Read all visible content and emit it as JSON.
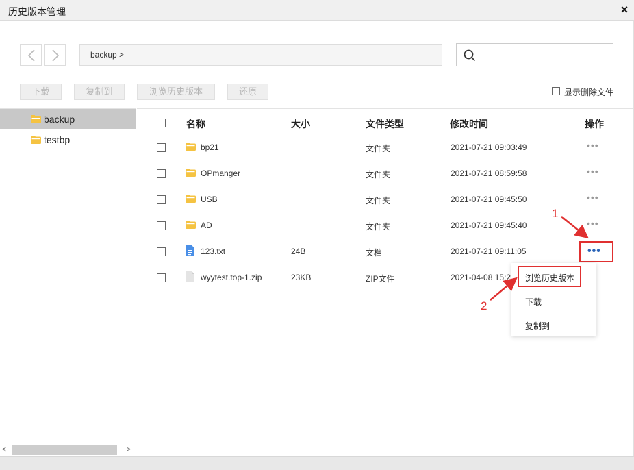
{
  "window": {
    "title": "历史版本管理",
    "close_glyph": "×"
  },
  "nav": {
    "back_icon": "chevron-left-icon",
    "forward_icon": "chevron-right-icon"
  },
  "breadcrumb": {
    "text": "backup  >"
  },
  "search": {
    "value": "",
    "placeholder": ""
  },
  "toolbar": {
    "download": "下载",
    "copy_to": "复制到",
    "browse_history": "浏览历史版本",
    "restore": "还原"
  },
  "show_deleted": {
    "label": "显示删除文件",
    "checked": false
  },
  "tree": [
    {
      "name": "backup",
      "selected": true
    },
    {
      "name": "testbp",
      "selected": false
    }
  ],
  "table": {
    "headers": {
      "name": "名称",
      "size": "大小",
      "type": "文件类型",
      "modified": "修改时间",
      "action": "操作"
    },
    "rows": [
      {
        "name": "bp21",
        "size": "",
        "type": "文件夹",
        "modified": "2021-07-21 09:03:49",
        "icon": "folder-icon"
      },
      {
        "name": "OPmanger",
        "size": "",
        "type": "文件夹",
        "modified": "2021-07-21 08:59:58",
        "icon": "folder-icon"
      },
      {
        "name": "USB",
        "size": "",
        "type": "文件夹",
        "modified": "2021-07-21 09:45:50",
        "icon": "folder-icon"
      },
      {
        "name": "AD",
        "size": "",
        "type": "文件夹",
        "modified": "2021-07-21 09:45:40",
        "icon": "folder-icon"
      },
      {
        "name": "123.txt",
        "size": "24B",
        "type": "文档",
        "modified": "2021-07-21 09:11:05",
        "icon": "document-icon"
      },
      {
        "name": "wyytest.top-1.zip",
        "size": "23KB",
        "type": "ZIP文件",
        "modified": "2021-04-08 15:2",
        "icon": "zip-file-icon"
      }
    ],
    "more_glyph": "•••"
  },
  "context_menu": {
    "items": [
      "浏览历史版本",
      "下载",
      "复制到"
    ]
  },
  "annotations": {
    "step1": "1",
    "step2": "2"
  },
  "colors": {
    "highlight": "#e03030",
    "folder": "#f5c342",
    "more_active": "#2a64b8"
  }
}
